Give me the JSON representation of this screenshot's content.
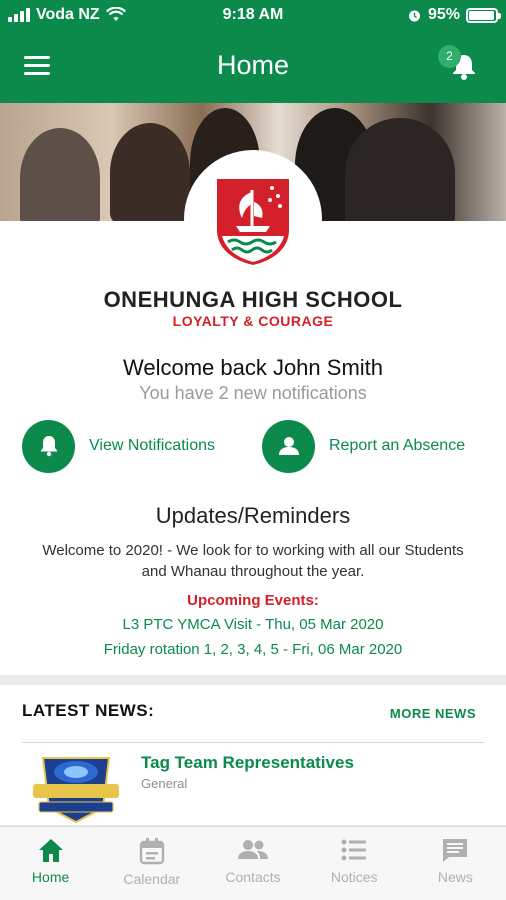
{
  "status_bar": {
    "carrier": "Voda NZ",
    "time": "9:18 AM",
    "battery": "95%",
    "battery_level": 0.95
  },
  "header": {
    "title": "Home",
    "notification_count": "2",
    "menu_icon": "hamburger-menu-icon",
    "bell_icon": "bell-icon"
  },
  "school": {
    "name": "ONEHUNGA HIGH SCHOOL",
    "motto": "LOYALTY & COURAGE"
  },
  "welcome": {
    "greeting": "Welcome back John Smith",
    "notifications_text": "You have 2 new notifications"
  },
  "actions": {
    "view_notifications": "View Notifications",
    "report_absence": "Report an Absence"
  },
  "updates": {
    "title": "Updates/Reminders",
    "text": "Welcome to 2020! - We look for to working with all our Students and Whanau throughout the year.",
    "upcoming_label": "Upcoming Events:",
    "events": [
      "L3 PTC YMCA Visit - Thu, 05 Mar 2020",
      "Friday rotation 1, 2, 3, 4, 5 - Fri, 06 Mar 2020"
    ]
  },
  "news": {
    "heading": "LATEST NEWS:",
    "more": "MORE NEWS",
    "items": [
      {
        "title": "Tag Team Representatives",
        "category": "General"
      }
    ]
  },
  "tabs": [
    {
      "label": "Home",
      "icon": "home-icon",
      "active": true
    },
    {
      "label": "Calendar",
      "icon": "calendar-icon",
      "active": false
    },
    {
      "label": "Contacts",
      "icon": "contacts-icon",
      "active": false
    },
    {
      "label": "Notices",
      "icon": "notices-icon",
      "active": false
    },
    {
      "label": "News",
      "icon": "news-icon",
      "active": false
    }
  ],
  "colors": {
    "brand_green": "#0b8a4b",
    "accent_red": "#d4202a"
  }
}
